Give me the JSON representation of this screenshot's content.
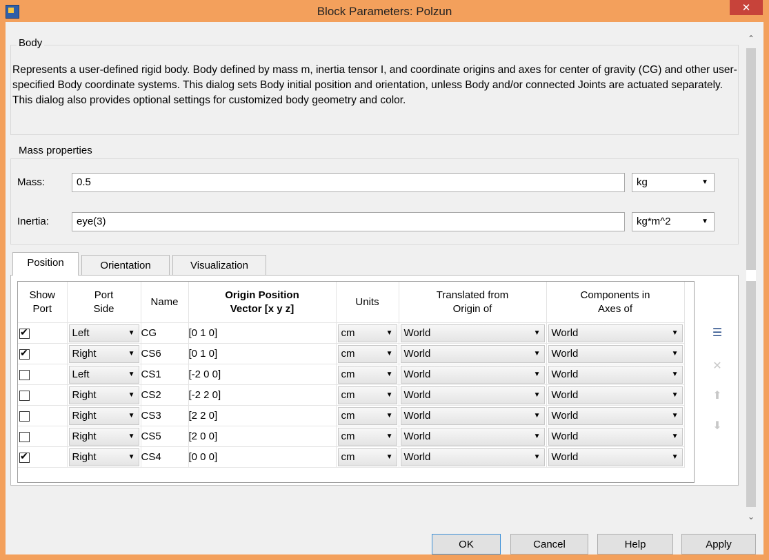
{
  "window": {
    "title": "Block Parameters: Polzun",
    "close_glyph": "✕",
    "icon": "simulink-block-icon"
  },
  "body_group": {
    "title": "Body",
    "description": "Represents a user-defined rigid body. Body defined by mass m, inertia tensor I, and coordinate origins and axes for center of gravity (CG) and other user-specified Body coordinate systems. This dialog sets Body initial position and orientation, unless Body and/or connected Joints are actuated separately. This dialog also provides optional settings for customized body geometry and color."
  },
  "mass_group": {
    "title": "Mass properties",
    "mass_label": "Mass:",
    "mass_value": "0.5",
    "mass_unit": "kg",
    "inertia_label": "Inertia:",
    "inertia_value": "eye(3)",
    "inertia_unit": "kg*m^2"
  },
  "tabs": [
    {
      "label": "Position",
      "active": true
    },
    {
      "label": "Orientation",
      "active": false
    },
    {
      "label": "Visualization",
      "active": false
    }
  ],
  "table": {
    "headers": {
      "show_port_1": "Show",
      "show_port_2": "Port",
      "port_side_1": "Port",
      "port_side_2": "Side",
      "name": "Name",
      "origin_1": "Origin Position",
      "origin_2": "Vector [x y z]",
      "units": "Units",
      "translated_1": "Translated from",
      "translated_2": "Origin of",
      "components_1": "Components in",
      "components_2": "Axes of"
    },
    "rows": [
      {
        "show": true,
        "side": "Left",
        "name": "CG",
        "origin": "[0 1 0]",
        "units": "cm",
        "translated": "World",
        "components": "World"
      },
      {
        "show": true,
        "side": "Right",
        "name": "CS6",
        "origin": "[0 1 0]",
        "units": "cm",
        "translated": "World",
        "components": "World"
      },
      {
        "show": false,
        "side": "Left",
        "name": "CS1",
        "origin": "[-2 0 0]",
        "units": "cm",
        "translated": "World",
        "components": "World"
      },
      {
        "show": false,
        "side": "Right",
        "name": "CS2",
        "origin": "[-2 2 0]",
        "units": "cm",
        "translated": "World",
        "components": "World"
      },
      {
        "show": false,
        "side": "Right",
        "name": "CS3",
        "origin": "[2 2 0]",
        "units": "cm",
        "translated": "World",
        "components": "World"
      },
      {
        "show": false,
        "side": "Right",
        "name": "CS5",
        "origin": "[2 0 0]",
        "units": "cm",
        "translated": "World",
        "components": "World"
      },
      {
        "show": true,
        "side": "Right",
        "name": "CS4",
        "origin": "[0 0 0]",
        "units": "cm",
        "translated": "World",
        "components": "World"
      }
    ]
  },
  "side_buttons": {
    "add_icon": "add-row-icon",
    "delete_icon": "delete-row-icon",
    "up_icon": "move-up-icon",
    "down_icon": "move-down-icon"
  },
  "buttons": {
    "ok": "OK",
    "cancel": "Cancel",
    "help": "Help",
    "apply": "Apply"
  },
  "colors": {
    "titlebar": "#f3a05c",
    "close": "#c7433a",
    "dialog_bg": "#f0f0f0"
  }
}
